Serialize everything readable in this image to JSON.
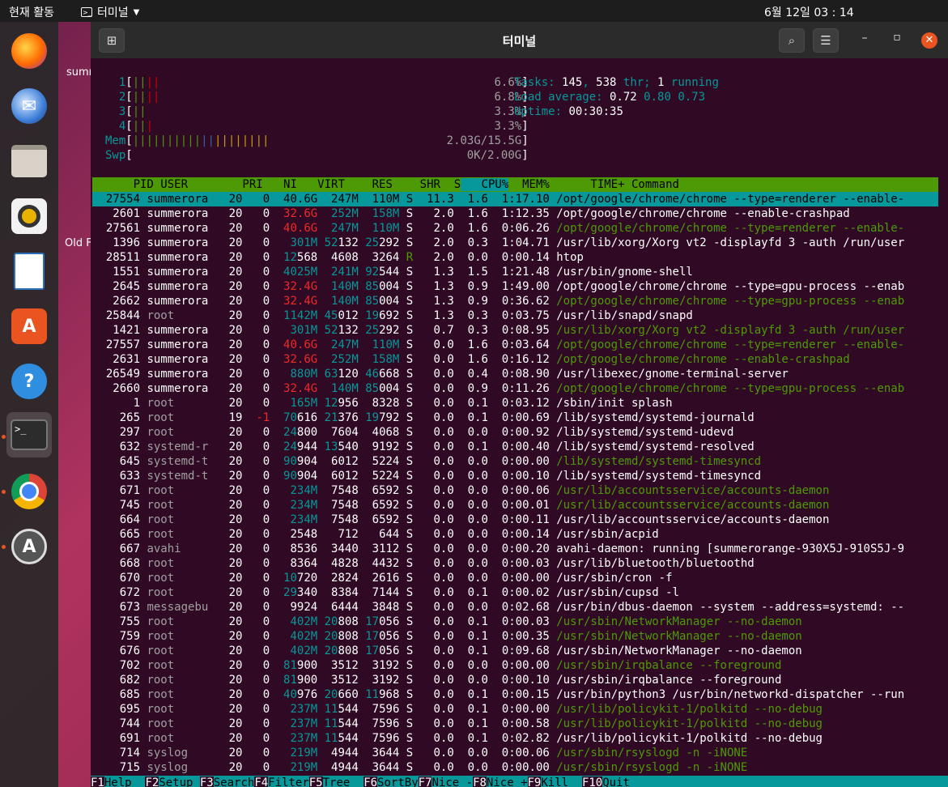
{
  "topbar": {
    "activities": "현재 활동",
    "app_name": "터미널",
    "clock": "6월 12일  03 : 14"
  },
  "dock": {
    "items": [
      "Firefox",
      "Thunderbird",
      "Files",
      "Rhythmbox",
      "LibreOffice Writer",
      "Ubuntu Software",
      "Help",
      "Terminal",
      "Chrome",
      "Software Updater"
    ]
  },
  "desktop": {
    "label1": "summ",
    "label2": "Old F"
  },
  "window": {
    "title": "터미널"
  },
  "meters": [
    {
      "label": "1",
      "bars": "[||||",
      "value": "6.6%]"
    },
    {
      "label": "2",
      "bars": "[||||",
      "value": "6.8%]"
    },
    {
      "label": "3",
      "bars": "[||",
      "value": "3.3%]"
    },
    {
      "label": "4",
      "bars": "[|||",
      "value": "3.3%]"
    },
    {
      "label": "Mem",
      "bars": "[||||||||||||||||||||",
      "value": "2.03G/15.5G]"
    },
    {
      "label": "Swp",
      "bars": "[",
      "value": "0K/2.00G]"
    }
  ],
  "summary": {
    "tasks_label": "Tasks: ",
    "tasks": "145",
    "thr_sep": ", ",
    "threads": "538",
    "thr_label": " thr; ",
    "running": "1",
    "running_label": " running",
    "load_label": "Load average: ",
    "load1": "0.72",
    "load5": "0.80",
    "load15": "0.73",
    "uptime_label": "Uptime: ",
    "uptime": "00:30:35"
  },
  "columns": [
    "PID",
    "USER",
    "PRI",
    "NI",
    "VIRT",
    "RES",
    "SHR",
    "S",
    "CPU%",
    "MEM%",
    "TIME+",
    "Command"
  ],
  "processes": [
    [
      "27554",
      "summerora",
      "20",
      "0",
      "40.6G",
      "247M",
      "110M",
      "S",
      "11.3",
      "1.6",
      "1:17.10",
      "/opt/google/chrome/chrome --type=renderer --enable-"
    ],
    [
      "2601",
      "summerora",
      "20",
      "0",
      "32.6G",
      "252M",
      "158M",
      "S",
      "2.0",
      "1.6",
      "1:12.35",
      "/opt/google/chrome/chrome --enable-crashpad"
    ],
    [
      "27561",
      "summerora",
      "20",
      "0",
      "40.6G",
      "247M",
      "110M",
      "S",
      "2.0",
      "1.6",
      "0:06.26",
      "/opt/google/chrome/chrome --type=renderer --enable-"
    ],
    [
      "1396",
      "summerora",
      "20",
      "0",
      "301M",
      "52132",
      "25292",
      "S",
      "2.0",
      "0.3",
      "1:04.71",
      "/usr/lib/xorg/Xorg vt2 -displayfd 3 -auth /run/user"
    ],
    [
      "28511",
      "summerora",
      "20",
      "0",
      "12568",
      "4608",
      "3264",
      "R",
      "2.0",
      "0.0",
      "0:00.14",
      "htop"
    ],
    [
      "1551",
      "summerora",
      "20",
      "0",
      "4025M",
      "241M",
      "92544",
      "S",
      "1.3",
      "1.5",
      "1:21.48",
      "/usr/bin/gnome-shell"
    ],
    [
      "2645",
      "summerora",
      "20",
      "0",
      "32.4G",
      "140M",
      "85004",
      "S",
      "1.3",
      "0.9",
      "1:49.00",
      "/opt/google/chrome/chrome --type=gpu-process --enab"
    ],
    [
      "2662",
      "summerora",
      "20",
      "0",
      "32.4G",
      "140M",
      "85004",
      "S",
      "1.3",
      "0.9",
      "0:36.62",
      "/opt/google/chrome/chrome --type=gpu-process --enab"
    ],
    [
      "25844",
      "root",
      "20",
      "0",
      "1142M",
      "45012",
      "19692",
      "S",
      "1.3",
      "0.3",
      "0:03.75",
      "/usr/lib/snapd/snapd"
    ],
    [
      "1421",
      "summerora",
      "20",
      "0",
      "301M",
      "52132",
      "25292",
      "S",
      "0.7",
      "0.3",
      "0:08.95",
      "/usr/lib/xorg/Xorg vt2 -displayfd 3 -auth /run/user"
    ],
    [
      "27557",
      "summerora",
      "20",
      "0",
      "40.6G",
      "247M",
      "110M",
      "S",
      "0.0",
      "1.6",
      "0:03.64",
      "/opt/google/chrome/chrome --type=renderer --enable-"
    ],
    [
      "2631",
      "summerora",
      "20",
      "0",
      "32.6G",
      "252M",
      "158M",
      "S",
      "0.0",
      "1.6",
      "0:16.12",
      "/opt/google/chrome/chrome --enable-crashpad"
    ],
    [
      "26549",
      "summerora",
      "20",
      "0",
      "880M",
      "63120",
      "46668",
      "S",
      "0.0",
      "0.4",
      "0:08.90",
      "/usr/libexec/gnome-terminal-server"
    ],
    [
      "2660",
      "summerora",
      "20",
      "0",
      "32.4G",
      "140M",
      "85004",
      "S",
      "0.0",
      "0.9",
      "0:11.26",
      "/opt/google/chrome/chrome --type=gpu-process --enab"
    ],
    [
      "1",
      "root",
      "20",
      "0",
      "165M",
      "12956",
      "8328",
      "S",
      "0.0",
      "0.1",
      "0:03.12",
      "/sbin/init splash"
    ],
    [
      "265",
      "root",
      "19",
      "-1",
      "70616",
      "21376",
      "19792",
      "S",
      "0.0",
      "0.1",
      "0:00.69",
      "/lib/systemd/systemd-journald"
    ],
    [
      "297",
      "root",
      "20",
      "0",
      "24800",
      "7604",
      "4068",
      "S",
      "0.0",
      "0.0",
      "0:00.92",
      "/lib/systemd/systemd-udevd"
    ],
    [
      "632",
      "systemd-r",
      "20",
      "0",
      "24944",
      "13540",
      "9192",
      "S",
      "0.0",
      "0.1",
      "0:00.40",
      "/lib/systemd/systemd-resolved"
    ],
    [
      "645",
      "systemd-t",
      "20",
      "0",
      "90904",
      "6012",
      "5224",
      "S",
      "0.0",
      "0.0",
      "0:00.00",
      "/lib/systemd/systemd-timesyncd"
    ],
    [
      "633",
      "systemd-t",
      "20",
      "0",
      "90904",
      "6012",
      "5224",
      "S",
      "0.0",
      "0.0",
      "0:00.10",
      "/lib/systemd/systemd-timesyncd"
    ],
    [
      "671",
      "root",
      "20",
      "0",
      "234M",
      "7548",
      "6592",
      "S",
      "0.0",
      "0.0",
      "0:00.06",
      "/usr/lib/accountsservice/accounts-daemon"
    ],
    [
      "745",
      "root",
      "20",
      "0",
      "234M",
      "7548",
      "6592",
      "S",
      "0.0",
      "0.0",
      "0:00.01",
      "/usr/lib/accountsservice/accounts-daemon"
    ],
    [
      "664",
      "root",
      "20",
      "0",
      "234M",
      "7548",
      "6592",
      "S",
      "0.0",
      "0.0",
      "0:00.11",
      "/usr/lib/accountsservice/accounts-daemon"
    ],
    [
      "665",
      "root",
      "20",
      "0",
      "2548",
      "712",
      "644",
      "S",
      "0.0",
      "0.0",
      "0:00.14",
      "/usr/sbin/acpid"
    ],
    [
      "667",
      "avahi",
      "20",
      "0",
      "8536",
      "3440",
      "3112",
      "S",
      "0.0",
      "0.0",
      "0:00.20",
      "avahi-daemon: running [summerorange-930X5J-910S5J-9"
    ],
    [
      "668",
      "root",
      "20",
      "0",
      "8364",
      "4828",
      "4432",
      "S",
      "0.0",
      "0.0",
      "0:00.03",
      "/usr/lib/bluetooth/bluetoothd"
    ],
    [
      "670",
      "root",
      "20",
      "0",
      "10720",
      "2824",
      "2616",
      "S",
      "0.0",
      "0.0",
      "0:00.00",
      "/usr/sbin/cron -f"
    ],
    [
      "672",
      "root",
      "20",
      "0",
      "29340",
      "8384",
      "7144",
      "S",
      "0.0",
      "0.1",
      "0:00.02",
      "/usr/sbin/cupsd -l"
    ],
    [
      "673",
      "messagebu",
      "20",
      "0",
      "9924",
      "6444",
      "3848",
      "S",
      "0.0",
      "0.0",
      "0:02.68",
      "/usr/bin/dbus-daemon --system --address=systemd: --"
    ],
    [
      "755",
      "root",
      "20",
      "0",
      "402M",
      "20808",
      "17056",
      "S",
      "0.0",
      "0.1",
      "0:00.03",
      "/usr/sbin/NetworkManager --no-daemon"
    ],
    [
      "759",
      "root",
      "20",
      "0",
      "402M",
      "20808",
      "17056",
      "S",
      "0.0",
      "0.1",
      "0:00.35",
      "/usr/sbin/NetworkManager --no-daemon"
    ],
    [
      "676",
      "root",
      "20",
      "0",
      "402M",
      "20808",
      "17056",
      "S",
      "0.0",
      "0.1",
      "0:09.68",
      "/usr/sbin/NetworkManager --no-daemon"
    ],
    [
      "702",
      "root",
      "20",
      "0",
      "81900",
      "3512",
      "3192",
      "S",
      "0.0",
      "0.0",
      "0:00.00",
      "/usr/sbin/irqbalance --foreground"
    ],
    [
      "682",
      "root",
      "20",
      "0",
      "81900",
      "3512",
      "3192",
      "S",
      "0.0",
      "0.0",
      "0:00.10",
      "/usr/sbin/irqbalance --foreground"
    ],
    [
      "685",
      "root",
      "20",
      "0",
      "40976",
      "20660",
      "11968",
      "S",
      "0.0",
      "0.1",
      "0:00.15",
      "/usr/bin/python3 /usr/bin/networkd-dispatcher --run"
    ],
    [
      "695",
      "root",
      "20",
      "0",
      "237M",
      "11544",
      "7596",
      "S",
      "0.0",
      "0.1",
      "0:00.00",
      "/usr/lib/policykit-1/polkitd --no-debug"
    ],
    [
      "744",
      "root",
      "20",
      "0",
      "237M",
      "11544",
      "7596",
      "S",
      "0.0",
      "0.1",
      "0:00.58",
      "/usr/lib/policykit-1/polkitd --no-debug"
    ],
    [
      "691",
      "root",
      "20",
      "0",
      "237M",
      "11544",
      "7596",
      "S",
      "0.0",
      "0.1",
      "0:02.82",
      "/usr/lib/policykit-1/polkitd --no-debug"
    ],
    [
      "714",
      "syslog",
      "20",
      "0",
      "219M",
      "4944",
      "3644",
      "S",
      "0.0",
      "0.0",
      "0:00.06",
      "/usr/sbin/rsyslogd -n -iNONE"
    ],
    [
      "715",
      "syslog",
      "20",
      "0",
      "219M",
      "4944",
      "3644",
      "S",
      "0.0",
      "0.0",
      "0:00.00",
      "/usr/sbin/rsyslogd -n -iNONE"
    ]
  ],
  "fkeys": [
    {
      "key": "F1",
      "label": "Help  "
    },
    {
      "key": "F2",
      "label": "Setup "
    },
    {
      "key": "F3",
      "label": "Search"
    },
    {
      "key": "F4",
      "label": "Filter"
    },
    {
      "key": "F5",
      "label": "Tree  "
    },
    {
      "key": "F6",
      "label": "SortBy"
    },
    {
      "key": "F7",
      "label": "Nice -"
    },
    {
      "key": "F8",
      "label": "Nice +"
    },
    {
      "key": "F9",
      "label": "Kill  "
    },
    {
      "key": "F10",
      "label": "Quit"
    }
  ],
  "colors": {
    "terminal_bg": "#300a24",
    "header_bg": "#4e9a06",
    "selection_bg": "#06989a",
    "accent": "#e95420"
  }
}
